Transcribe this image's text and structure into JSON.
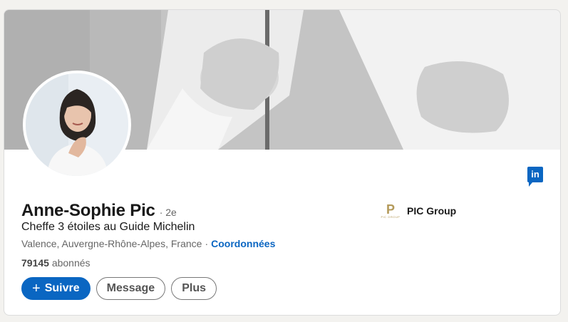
{
  "profile": {
    "name": "Anne-Sophie Pic",
    "degree": "· 2e",
    "headline": "Cheffe 3 étoiles au Guide Michelin",
    "location": "Valence, Auvergne-Rhône-Alpes, France",
    "separator": "·",
    "contact_link": "Coordonnées",
    "followers_count": "79145",
    "followers_label": "abonnés"
  },
  "actions": {
    "follow_label": "Suivre",
    "message_label": "Message",
    "more_label": "Plus"
  },
  "company": {
    "name": "PIC Group",
    "logo_letter": "P",
    "logo_small": "PIC GROUP"
  },
  "brand": {
    "logo_text": "in",
    "accent_color": "#0a66c2"
  },
  "icons": [
    "linkedin-icon",
    "plus-icon"
  ]
}
